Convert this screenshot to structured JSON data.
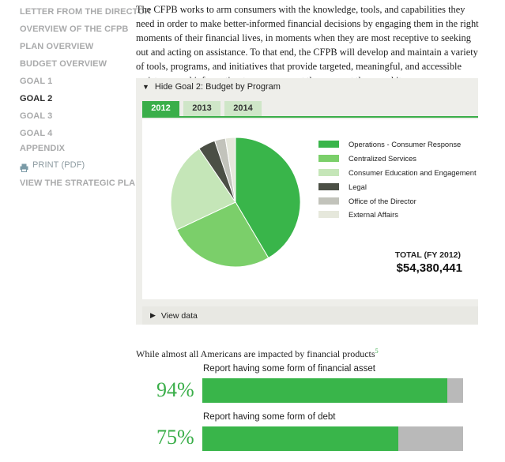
{
  "sidebar": {
    "items": [
      {
        "label": "LETTER FROM THE DIRECTOR"
      },
      {
        "label": "OVERVIEW OF THE CFPB"
      },
      {
        "label": "PLAN OVERVIEW"
      },
      {
        "label": "BUDGET OVERVIEW"
      },
      {
        "label": "GOAL 1"
      },
      {
        "label": "GOAL 2",
        "active": true
      },
      {
        "label": "GOAL 3"
      },
      {
        "label": "GOAL 4"
      },
      {
        "label": "APPENDIX"
      },
      {
        "label": "PRINT (PDF)",
        "icon": "printer-icon"
      },
      {
        "label": "VIEW THE STRATEGIC PLAN"
      }
    ]
  },
  "intro": {
    "text": "The CFPB works to arm consumers with the knowledge, tools, and capabilities they need in order to make better-informed financial decisions by engaging them in the right moments of their financial lives, in moments when they are most receptive to seeking out and acting on assistance. To that end, the CFPB will develop and maintain a variety of tools, programs, and initiatives that provide targeted, meaningful, and accessible assistance and information to consumers at the moment they need it."
  },
  "panel": {
    "toggle_label": "Hide Goal 2: Budget by Program",
    "tabs": [
      "2012",
      "2013",
      "2014"
    ],
    "active_tab": "2012",
    "total_label": "TOTAL (FY 2012)",
    "total_value": "$54,380,441",
    "view_data_label": "View data"
  },
  "colors": {
    "accent": "#3aae49"
  },
  "chart_data": {
    "type": "pie",
    "series": [
      {
        "name": "Operations - Consumer Response",
        "value": 41.5,
        "color": "#39b54a"
      },
      {
        "name": "Centralized Services",
        "value": 26.5,
        "color": "#7bcf6a"
      },
      {
        "name": "Consumer Education and Engagement",
        "value": 22.5,
        "color": "#c5e6b8"
      },
      {
        "name": "Legal",
        "value": 4.3,
        "color": "#4b4f45"
      },
      {
        "name": "Office of the Director",
        "value": 2.7,
        "color": "#c2c3bb"
      },
      {
        "name": "External Affairs",
        "value": 2.5,
        "color": "#e6e8dc"
      }
    ]
  },
  "stats": {
    "lead": "While almost all Americans are impacted by financial products",
    "lead_sup": "5",
    "items": [
      {
        "label": "Report having some form of financial asset",
        "percent_text": "94%",
        "percent": 94
      },
      {
        "label": "Report having some form of debt",
        "percent_text": "75%",
        "percent": 75
      }
    ]
  }
}
